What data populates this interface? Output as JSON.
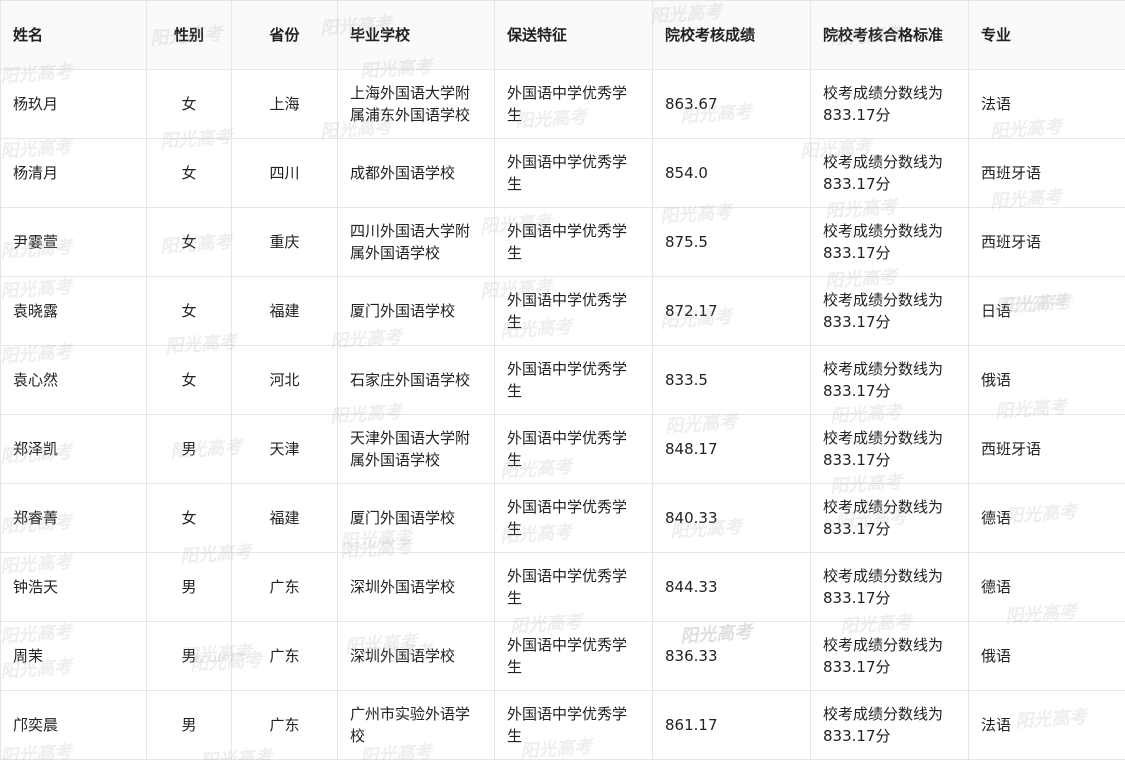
{
  "table": {
    "headers": [
      "姓名",
      "性别",
      "省份",
      "毕业学校",
      "保送特征",
      "院校考核成绩",
      "院校考核合格标准",
      "专业"
    ],
    "rows": [
      [
        "杨玖月",
        "女",
        "上海",
        "上海外国语大学附属浦东外国语学校",
        "外国语中学优秀学生",
        "863.67",
        "校考成绩分数线为833.17分",
        "法语"
      ],
      [
        "杨清月",
        "女",
        "四川",
        "成都外国语学校",
        "外国语中学优秀学生",
        "854.0",
        "校考成绩分数线为833.17分",
        "西班牙语"
      ],
      [
        "尹霎萱",
        "女",
        "重庆",
        "四川外国语大学附属外国语学校",
        "外国语中学优秀学生",
        "875.5",
        "校考成绩分数线为833.17分",
        "西班牙语"
      ],
      [
        "袁晓露",
        "女",
        "福建",
        "厦门外国语学校",
        "外国语中学优秀学生",
        "872.17",
        "校考成绩分数线为833.17分",
        "日语"
      ],
      [
        "袁心然",
        "女",
        "河北",
        "石家庄外国语学校",
        "外国语中学优秀学生",
        "833.5",
        "校考成绩分数线为833.17分",
        "俄语"
      ],
      [
        "郑泽凯",
        "男",
        "天津",
        "天津外国语大学附属外国语学校",
        "外国语中学优秀学生",
        "848.17",
        "校考成绩分数线为833.17分",
        "西班牙语"
      ],
      [
        "郑睿菁",
        "女",
        "福建",
        "厦门外国语学校",
        "外国语中学优秀学生",
        "840.33",
        "校考成绩分数线为833.17分",
        "德语"
      ],
      [
        "钟浩天",
        "男",
        "广东",
        "深圳外国语学校",
        "外国语中学优秀学生",
        "844.33",
        "校考成绩分数线为833.17分",
        "德语"
      ],
      [
        "周茉",
        "男",
        "广东",
        "深圳外国语学校",
        "外国语中学优秀学生",
        "836.33",
        "校考成绩分数线为833.17分",
        "俄语"
      ],
      [
        "邝奕晨",
        "男",
        "广东",
        "广州市实验外语学校",
        "外国语中学优秀学生",
        "861.17",
        "校考成绩分数线为833.17分",
        "法语"
      ]
    ]
  },
  "watermark": {
    "text": "阳光高考"
  }
}
